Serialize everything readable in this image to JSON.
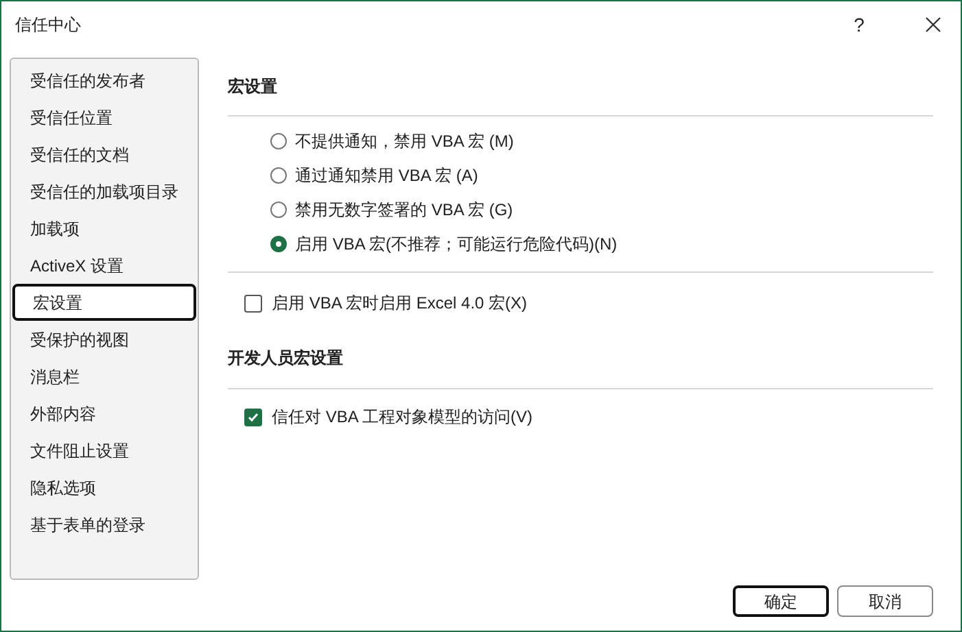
{
  "window": {
    "title": "信任中心",
    "help": "?"
  },
  "sidebar": {
    "items": [
      {
        "label": "受信任的发布者",
        "selected": false
      },
      {
        "label": "受信任位置",
        "selected": false
      },
      {
        "label": "受信任的文档",
        "selected": false
      },
      {
        "label": "受信任的加载项目录",
        "selected": false
      },
      {
        "label": "加载项",
        "selected": false
      },
      {
        "label": "ActiveX 设置",
        "selected": false
      },
      {
        "label": "宏设置",
        "selected": true
      },
      {
        "label": "受保护的视图",
        "selected": false
      },
      {
        "label": "消息栏",
        "selected": false
      },
      {
        "label": "外部内容",
        "selected": false
      },
      {
        "label": "文件阻止设置",
        "selected": false
      },
      {
        "label": "隐私选项",
        "selected": false
      },
      {
        "label": "基于表单的登录",
        "selected": false
      }
    ]
  },
  "macro_settings": {
    "heading": "宏设置",
    "options": [
      {
        "label": "不提供通知，禁用 VBA 宏 (M)",
        "selected": false
      },
      {
        "label": "通过通知禁用 VBA 宏 (A)",
        "selected": false
      },
      {
        "label": "禁用无数字签署的 VBA 宏 (G)",
        "selected": false
      },
      {
        "label": "启用 VBA 宏(不推荐；可能运行危险代码)(N)",
        "selected": true
      }
    ],
    "excel4_checkbox": {
      "label": "启用 VBA 宏时启用 Excel 4.0 宏(X)",
      "checked": false
    }
  },
  "developer_settings": {
    "heading": "开发人员宏设置",
    "checkbox": {
      "label": "信任对 VBA 工程对象模型的访问(V)",
      "checked": true
    }
  },
  "buttons": [
    {
      "label": "确定",
      "default": true
    },
    {
      "label": "取消",
      "default": false
    }
  ]
}
